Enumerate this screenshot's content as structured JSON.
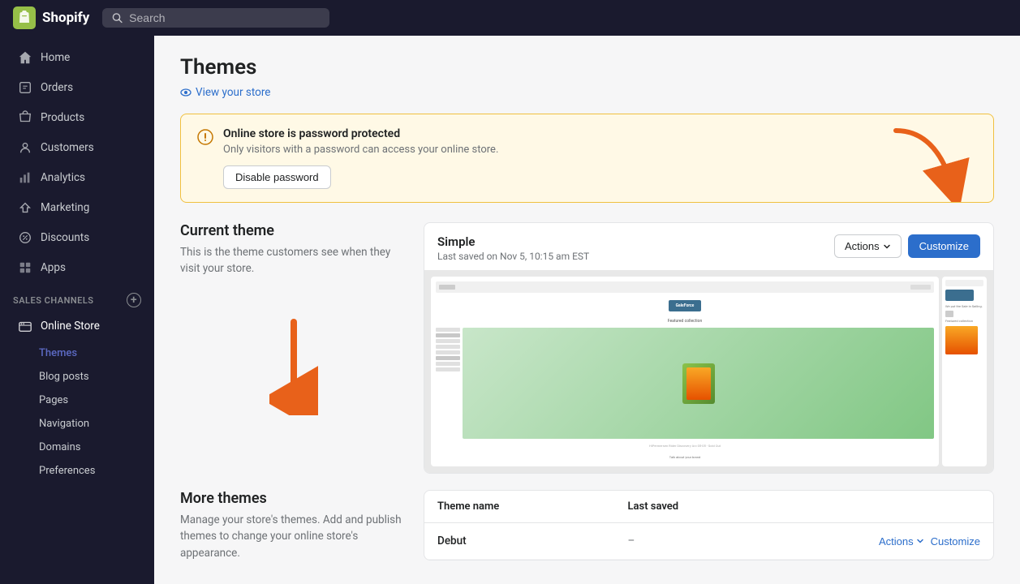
{
  "topbar": {
    "brand_name": "shopify",
    "search_placeholder": "Search"
  },
  "sidebar": {
    "nav_items": [
      {
        "label": "Home",
        "icon": "home"
      },
      {
        "label": "Orders",
        "icon": "orders"
      },
      {
        "label": "Products",
        "icon": "products"
      },
      {
        "label": "Customers",
        "icon": "customers"
      },
      {
        "label": "Analytics",
        "icon": "analytics"
      },
      {
        "label": "Marketing",
        "icon": "marketing"
      },
      {
        "label": "Discounts",
        "icon": "discounts"
      },
      {
        "label": "Apps",
        "icon": "apps"
      }
    ],
    "sales_channels_label": "Sales Channels",
    "online_store_label": "Online Store",
    "sub_items": [
      {
        "label": "Themes",
        "active": true
      },
      {
        "label": "Blog posts"
      },
      {
        "label": "Pages"
      },
      {
        "label": "Navigation"
      },
      {
        "label": "Domains"
      },
      {
        "label": "Preferences"
      }
    ]
  },
  "page": {
    "title": "Themes",
    "view_store_label": "View your store"
  },
  "password_banner": {
    "title": "Online store is password protected",
    "description": "Only visitors with a password can access your online store.",
    "button_label": "Disable password"
  },
  "current_theme": {
    "section_title": "Current theme",
    "section_desc": "This is the theme customers see when they visit your store.",
    "theme_name": "Simple",
    "last_saved": "Last saved on Nov 5, 10:15 am EST",
    "actions_label": "Actions",
    "customize_label": "Customize"
  },
  "more_themes": {
    "section_title": "More themes",
    "section_desc": "Manage your store's themes. Add and publish themes to change your online store's appearance.",
    "table": {
      "col_name": "Theme name",
      "col_saved": "Last saved",
      "rows": [
        {
          "name": "Debut",
          "saved": "–",
          "actions_label": "Actions",
          "customize_label": "Customize"
        }
      ]
    }
  }
}
